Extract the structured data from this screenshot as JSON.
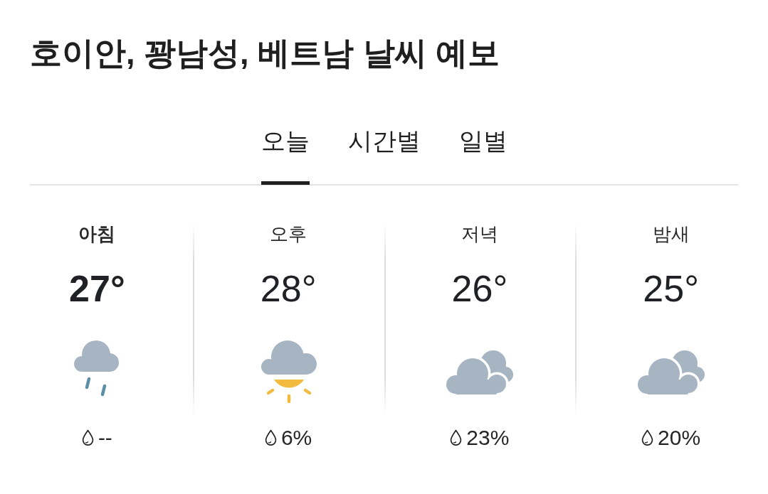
{
  "title": "호이안, 꽝남성, 베트남 날씨 예보",
  "tabs": [
    {
      "label": "오늘",
      "selected": true
    },
    {
      "label": "시간별",
      "selected": false
    },
    {
      "label": "일별",
      "selected": false
    }
  ],
  "periods": [
    {
      "name": "아침",
      "selected": true,
      "temperature": "27°",
      "kind": "rain",
      "precipitation": "--"
    },
    {
      "name": "오후",
      "selected": false,
      "temperature": "28°",
      "kind": "cloud-sun",
      "precipitation": "6%"
    },
    {
      "name": "저녁",
      "selected": false,
      "temperature": "26°",
      "kind": "clouds",
      "precipitation": "23%"
    },
    {
      "name": "밤새",
      "selected": false,
      "temperature": "25°",
      "kind": "clouds",
      "precipitation": "20%"
    }
  ]
}
